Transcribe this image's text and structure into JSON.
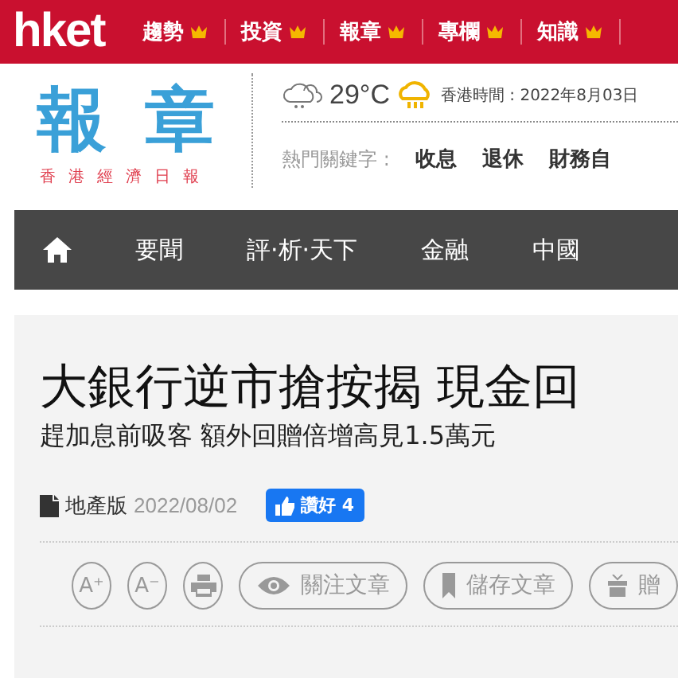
{
  "top_bar": {
    "logo": "hket",
    "items": [
      {
        "label": "趨勢"
      },
      {
        "label": "投資"
      },
      {
        "label": "報章"
      },
      {
        "label": "專欄"
      },
      {
        "label": "知識"
      }
    ]
  },
  "masthead": {
    "title_chars": [
      "報",
      "章"
    ],
    "subtitle": "香港經濟日報",
    "temperature": "29°C",
    "time": "香港時間 : 2022年8月03日",
    "keywords_label": "熱門關鍵字 :",
    "keywords": [
      "收息",
      "退休",
      "財務自"
    ]
  },
  "nav": {
    "items": [
      {
        "label": "要聞"
      },
      {
        "label": "評·析·天下"
      },
      {
        "label": "金融"
      },
      {
        "label": "中國"
      }
    ]
  },
  "article": {
    "headline": "大銀行逆市搶按揭 現金回",
    "subheadline": "趕加息前吸客 額外回贈倍增高見1.5萬元",
    "section": "地產版",
    "date": "2022/08/02",
    "like_label": "讚好",
    "like_count": "4",
    "tools": [
      {
        "kind": "circle",
        "label": "A⁺"
      },
      {
        "kind": "circle",
        "label": "A⁻"
      },
      {
        "kind": "print"
      },
      {
        "kind": "follow",
        "label": "關注文章"
      },
      {
        "kind": "save",
        "label": "儲存文章"
      },
      {
        "kind": "gift",
        "label": "贈"
      }
    ]
  }
}
